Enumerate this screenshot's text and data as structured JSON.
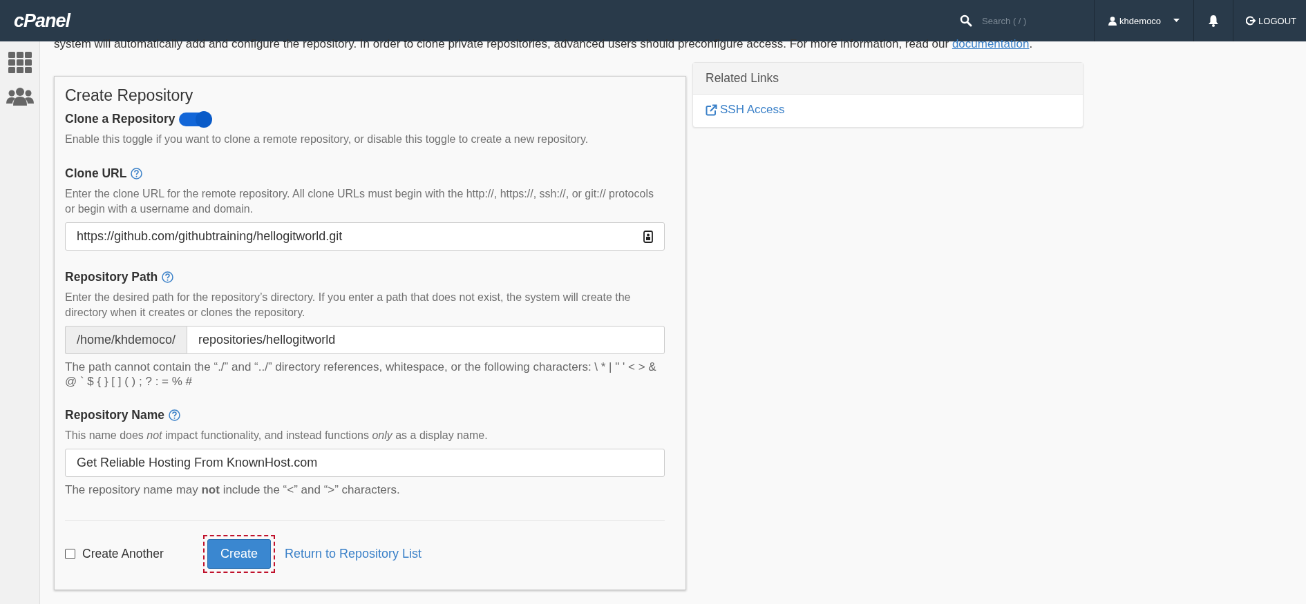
{
  "header": {
    "logo": "cPanel",
    "search": {
      "placeholder": "Search ( / )"
    },
    "user": "khdemoco",
    "logout": "LOGOUT"
  },
  "intro": {
    "text": "system will automatically add and configure the repository. In order to clone private repositories, advanced users should preconfigure access. For more information, read our ",
    "link": "documentation",
    "end": "."
  },
  "form": {
    "title": "Create Repository",
    "toggle": {
      "label": "Clone a Repository",
      "on": true,
      "help": "Enable this toggle if you want to clone a remote repository, or disable this toggle to create a new repository."
    },
    "fields": [
      {
        "kind": "text",
        "label": "Clone URL",
        "help": "Enter the clone URL for the remote repository. All clone URLs must begin with the http://, https://, ssh://, or git:// protocols or begin with a username and domain.",
        "value": "https://github.com/githubtraining/hellogitworld.git"
      },
      {
        "kind": "prefixed",
        "label": "Repository Path",
        "help": "Enter the desired path for the repository’s directory. If you enter a path that does not exist, the system will create the directory when it creates or clones the repository.",
        "prefix": "/home/khdemoco/",
        "value": "repositories/hellogitworld",
        "note": "The path cannot contain the “./” and “../” directory references, whitespace, or the following characters: \\ * | \" ' < > & @ ` $ { } [ ] ( ) ; ? : = % #"
      },
      {
        "kind": "plain",
        "label": "Repository Name",
        "help": "This name does *not* impact functionality, and instead functions *only* as a display name.",
        "value": "Get Reliable Hosting From KnownHost.com",
        "note": "The repository name may **not** include the “<” and “>” characters."
      }
    ],
    "create_another": {
      "label": "Create Another",
      "checked": false
    },
    "create_button": "Create",
    "return_link": "Return to Repository List"
  },
  "related": {
    "title": "Related Links",
    "links": [
      "SSH Access"
    ]
  }
}
